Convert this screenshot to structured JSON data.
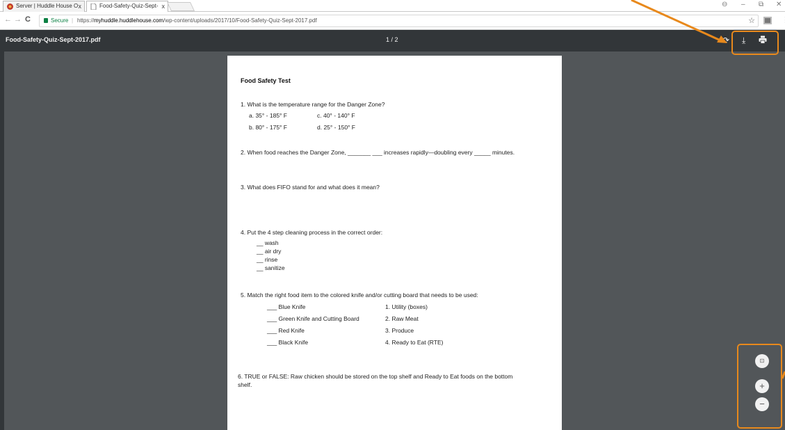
{
  "browser": {
    "tabs": [
      {
        "title": "Server | Huddle House O",
        "close": "x"
      },
      {
        "title": "Food-Safety-Quiz-Sept-",
        "close": "x"
      }
    ],
    "nav": {
      "back": "←",
      "forward": "→",
      "reload": "C"
    },
    "address": {
      "secure_label": "Secure",
      "separator": "|",
      "scheme": "https://",
      "host": "myhuddle.huddlehouse.com",
      "path": "/wp-content/uploads/2017/10/Food-Safety-Quiz-Sept-2017.pdf",
      "bookmark_icon": "☆"
    },
    "window_controls": {
      "account": "⊖",
      "minimize": "–",
      "restore": "⧉",
      "close": "✕"
    }
  },
  "pdf_toolbar": {
    "filename": "Food-Safety-Quiz-Sept-2017.pdf",
    "page_indicator": "1 / 2",
    "rotate_icon": "⟳",
    "download_icon": "⤓",
    "print_icon": "🖶"
  },
  "document": {
    "title": "Food Safety Test",
    "q1": {
      "text": "1.   What is the temperature range for the Danger Zone?",
      "a": "a. 35° - 185° F",
      "c": "c. 40° - 140° F",
      "b": "b. 80° - 175° F",
      "d": "d. 25° - 150° F"
    },
    "q2": "2.   When food reaches the Danger Zone, _______ ___ increases rapidly—doubling every _____ minutes.",
    "q3": "3. What does FIFO stand for and what does it mean?",
    "q4": {
      "text": "4. Put the 4 step cleaning process in the correct order:",
      "steps": [
        "__ wash",
        "__ air dry",
        "__ rinse",
        "__ sanitize"
      ]
    },
    "q5": {
      "text": "5.   Match the right food item to the colored knife and/or cutting board that needs to be used:",
      "left": [
        "___ Blue Knife",
        "___ Green Knife and Cutting Board",
        "___  Red Knife",
        "___  Black Knife"
      ],
      "right": [
        "1. Utility (boxes)",
        "2. Raw Meat",
        "3. Produce",
        "4. Ready to Eat (RTE)"
      ]
    },
    "q6": {
      "line1": "6. TRUE or FALSE:  Raw chicken should be stored on the top shelf and Ready to Eat foods on the bottom",
      "line2": "shelf."
    }
  },
  "zoom": {
    "fit": "⊡",
    "zoom_in": "+",
    "zoom_out": "−"
  },
  "colors": {
    "annotation": "#e8891c",
    "toolbar_bg": "#323639",
    "viewer_bg": "#525659",
    "secure_green": "#0b8043"
  }
}
